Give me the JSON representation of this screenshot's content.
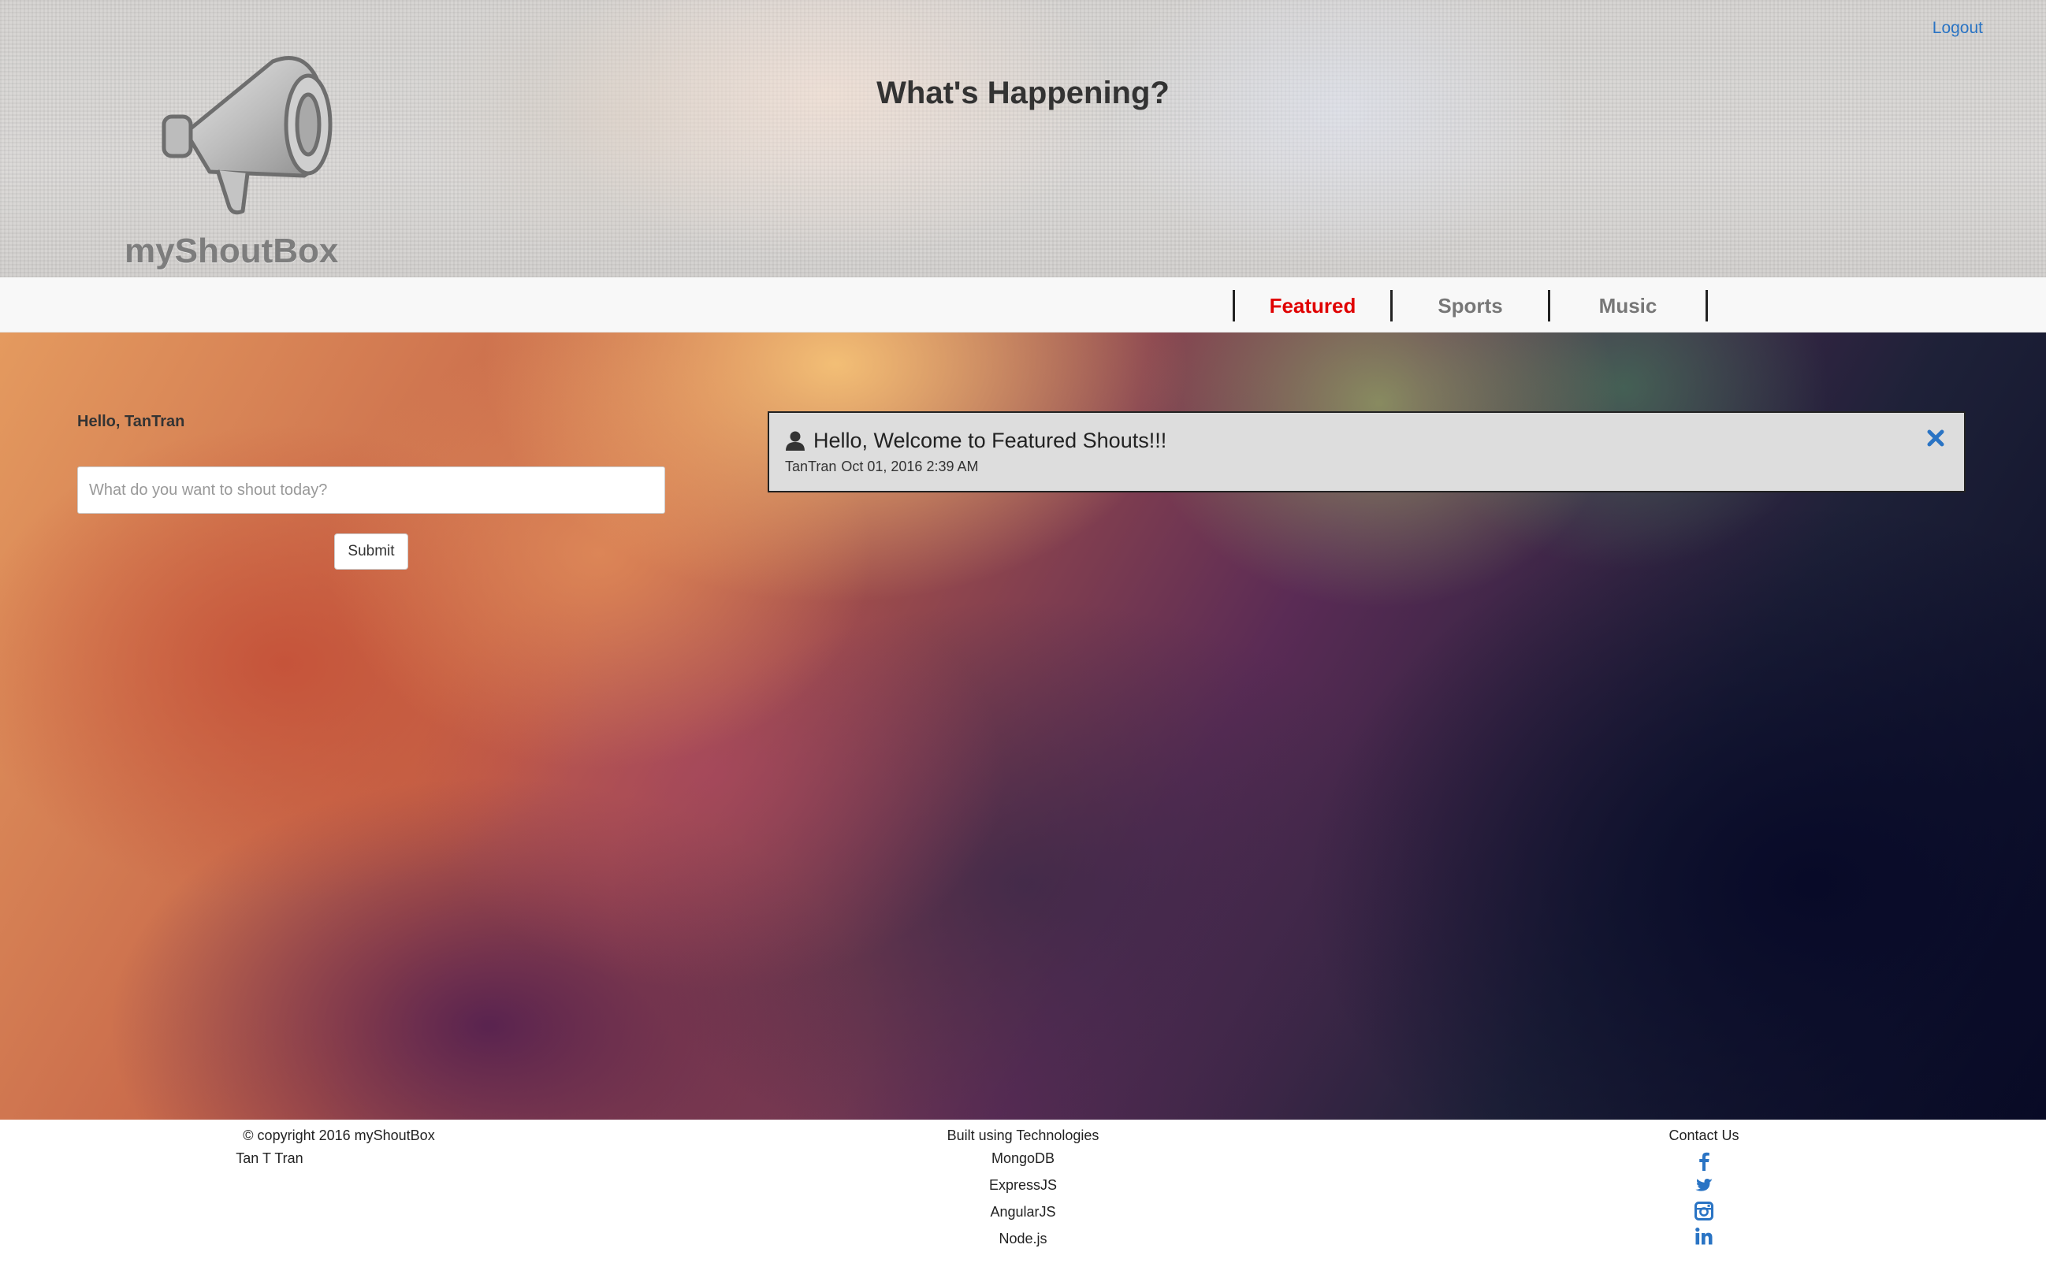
{
  "header": {
    "logo_text": "myShoutBox",
    "title": "What's Happening?",
    "logout_label": "Logout"
  },
  "nav": {
    "tabs": [
      {
        "label": "Featured",
        "active": true
      },
      {
        "label": "Sports",
        "active": false
      },
      {
        "label": "Music",
        "active": false
      }
    ],
    "active_color": "#e00000"
  },
  "compose": {
    "greeting": "Hello, TanTran",
    "placeholder": "What do you want to shout today?",
    "value": "",
    "submit_label": "Submit"
  },
  "shouts": [
    {
      "icon": "user-icon",
      "message": "Hello, Welcome to Featured Shouts!!!",
      "author": "TanTran",
      "timestamp": "Oct 01, 2016 2:39 AM",
      "close_icon": "close-icon"
    }
  ],
  "footer": {
    "copyright": "© copyright 2016 myShoutBox",
    "author": "Tan T Tran",
    "tech_heading": "Built using Technologies",
    "technologies": [
      "MongoDB",
      "ExpressJS",
      "AngularJS",
      "Node.js"
    ],
    "contact_heading": "Contact Us",
    "social_icons": [
      "facebook-icon",
      "twitter-icon",
      "instagram-icon",
      "linkedin-icon"
    ],
    "link_color": "#2a74c4"
  }
}
